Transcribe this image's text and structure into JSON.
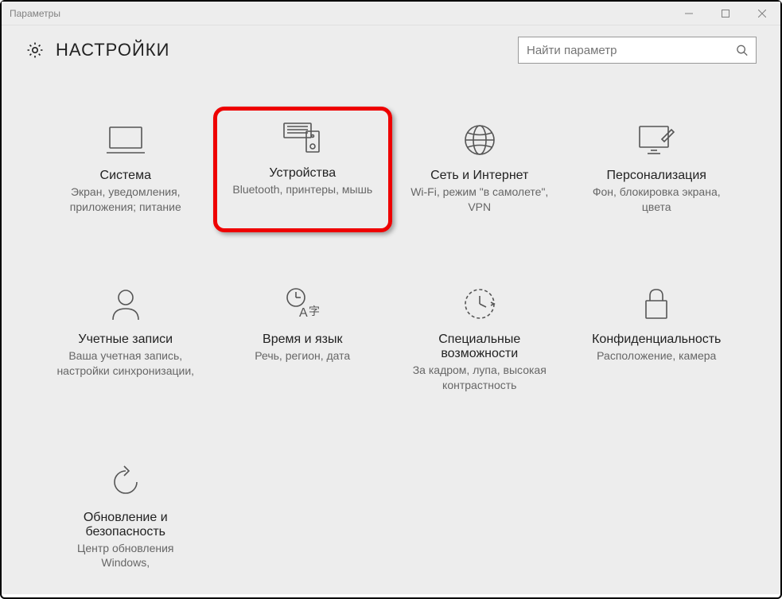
{
  "window": {
    "title": "Параметры"
  },
  "header": {
    "title": "НАСТРОЙКИ"
  },
  "search": {
    "placeholder": "Найти параметр"
  },
  "tiles": {
    "system": {
      "title": "Система",
      "desc": "Экран, уведомления, приложения; питание"
    },
    "devices": {
      "title": "Устройства",
      "desc": "Bluetooth, принтеры, мышь"
    },
    "network": {
      "title": "Сеть и Интернет",
      "desc": "Wi-Fi, режим \"в самолете\", VPN"
    },
    "personalization": {
      "title": "Персонализация",
      "desc": "Фон, блокировка экрана, цвета"
    },
    "accounts": {
      "title": "Учетные записи",
      "desc": "Ваша учетная запись, настройки синхронизации,"
    },
    "time": {
      "title": "Время и язык",
      "desc": "Речь, регион, дата"
    },
    "ease": {
      "title": "Специальные возможности",
      "desc": "За кадром, лупа, высокая контрастность"
    },
    "privacy": {
      "title": "Конфиденциальность",
      "desc": "Расположение, камера"
    },
    "update": {
      "title": "Обновление и безопасность",
      "desc": "Центр обновления Windows,"
    }
  }
}
